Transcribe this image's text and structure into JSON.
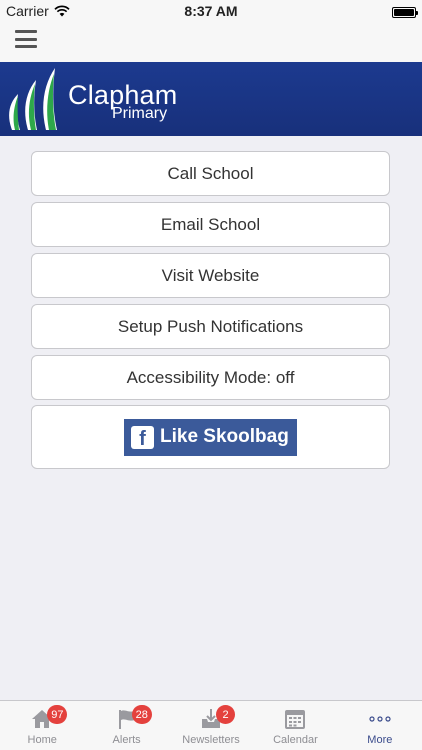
{
  "status_bar": {
    "carrier": "Carrier",
    "time": "8:37 AM"
  },
  "banner": {
    "title": "Clapham",
    "subtitle": "Primary"
  },
  "menu": {
    "call": "Call School",
    "email": "Email School",
    "website": "Visit Website",
    "push": "Setup Push Notifications",
    "accessibility": "Accessibility Mode: off",
    "facebook": "Like Skoolbag",
    "facebook_glyph": "f"
  },
  "tabs": [
    {
      "label": "Home",
      "badge": "97",
      "icon": "home-icon"
    },
    {
      "label": "Alerts",
      "badge": "28",
      "icon": "flag-icon"
    },
    {
      "label": "Newsletters",
      "badge": "2",
      "icon": "inbox-icon"
    },
    {
      "label": "Calendar",
      "badge": "",
      "icon": "calendar-icon"
    },
    {
      "label": "More",
      "badge": "",
      "icon": "more-icon"
    }
  ],
  "colors": {
    "banner": "#1c3a8f",
    "facebook": "#3b5a9a",
    "badge": "#e4413d",
    "active_tab": "#3b4c8c"
  }
}
